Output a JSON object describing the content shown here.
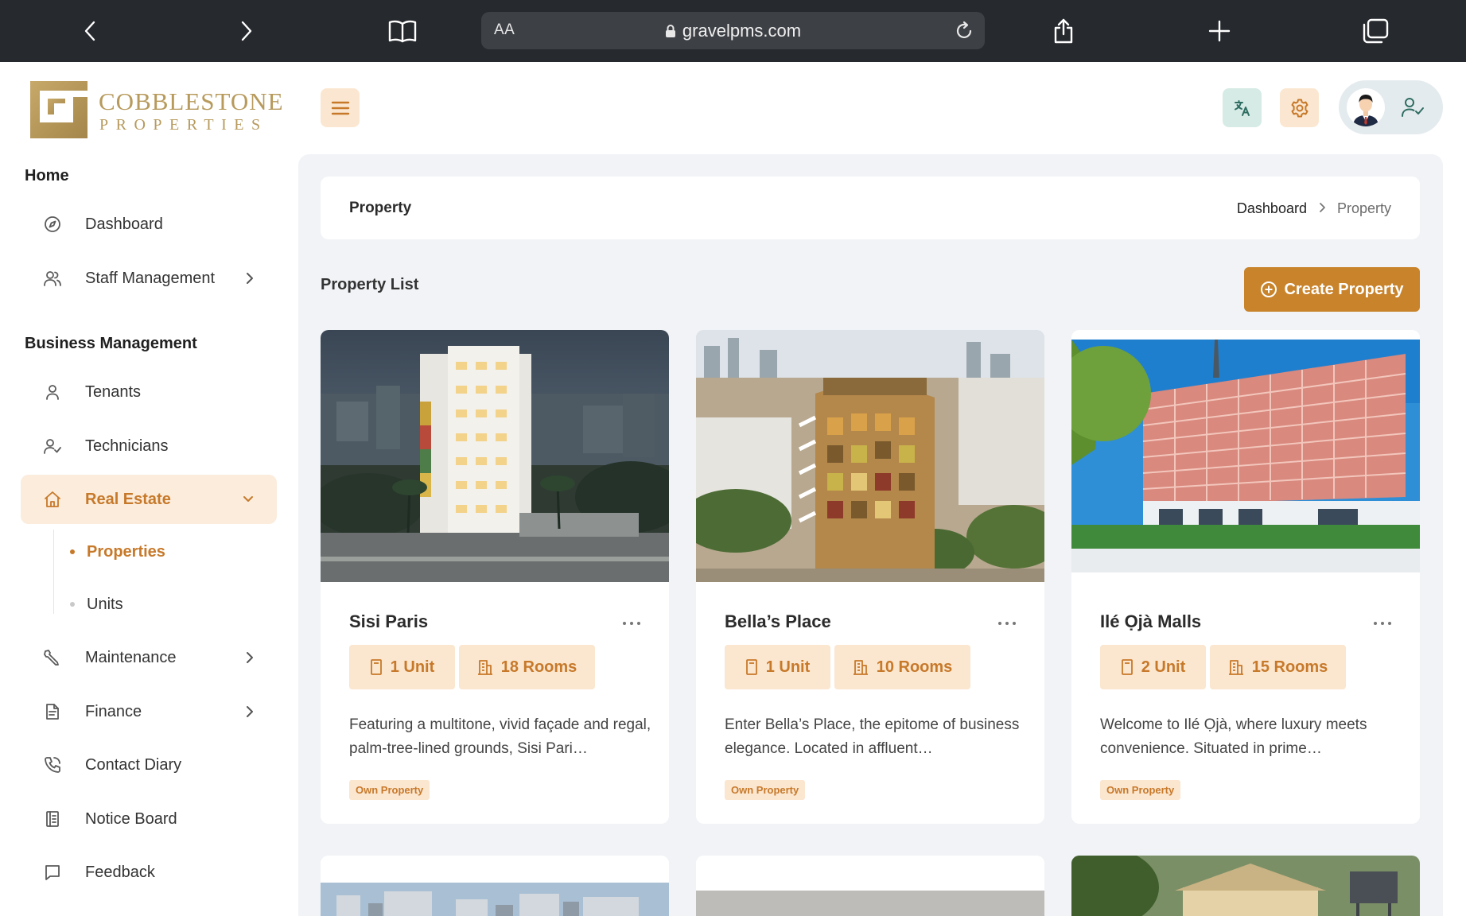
{
  "browser": {
    "aa_label": "AA",
    "url": "gravelpms.com"
  },
  "brand": {
    "name_line1": "COBBLESTONE",
    "name_line2": "PROPERTIES",
    "gold": "#b79a5c"
  },
  "sidebar": {
    "home_section": "Home",
    "home_items": [
      {
        "label": "Dashboard",
        "icon": "compass-icon"
      },
      {
        "label": "Staff Management",
        "icon": "users-icon"
      }
    ],
    "business_section": "Business Management",
    "business_items": [
      {
        "label": "Tenants",
        "icon": "user-icon"
      },
      {
        "label": "Technicians",
        "icon": "user-check-icon"
      },
      {
        "label": "Real Estate",
        "icon": "home-icon",
        "active": true
      },
      {
        "label": "Maintenance",
        "icon": "wrench-icon"
      },
      {
        "label": "Finance",
        "icon": "document-icon"
      },
      {
        "label": "Contact Diary",
        "icon": "phone-icon"
      },
      {
        "label": "Notice Board",
        "icon": "notice-board-icon"
      },
      {
        "label": "Feedback",
        "icon": "chat-bubble-icon"
      }
    ],
    "real_estate_sub": [
      {
        "label": "Properties",
        "active": true
      },
      {
        "label": "Units"
      }
    ]
  },
  "header": {
    "breadcrumb": [
      "Dashboard",
      "Property"
    ],
    "page_title": "Property"
  },
  "main": {
    "list_title": "Property List",
    "create_button": "Create Property",
    "accent_color": "#c8832b",
    "properties": [
      {
        "name": "Sisi Paris",
        "units": "1 Unit",
        "rooms": "18 Rooms",
        "description": "Featuring a multitone, vivid façade and regal, palm-tree-lined grounds, Sisi Pari…",
        "badge": "Own Property"
      },
      {
        "name": "Bella’s Place",
        "units": "1 Unit",
        "rooms": "10 Rooms",
        "description": "Enter Bella’s Place, the epitome of business elegance. Located in affluent…",
        "badge": "Own Property"
      },
      {
        "name": "Ilé Ọjà Malls",
        "units": "2 Unit",
        "rooms": "15 Rooms",
        "description": "Welcome to Ilé Ọjà, where luxury meets convenience. Situated in prime…",
        "badge": "Own Property"
      }
    ]
  }
}
